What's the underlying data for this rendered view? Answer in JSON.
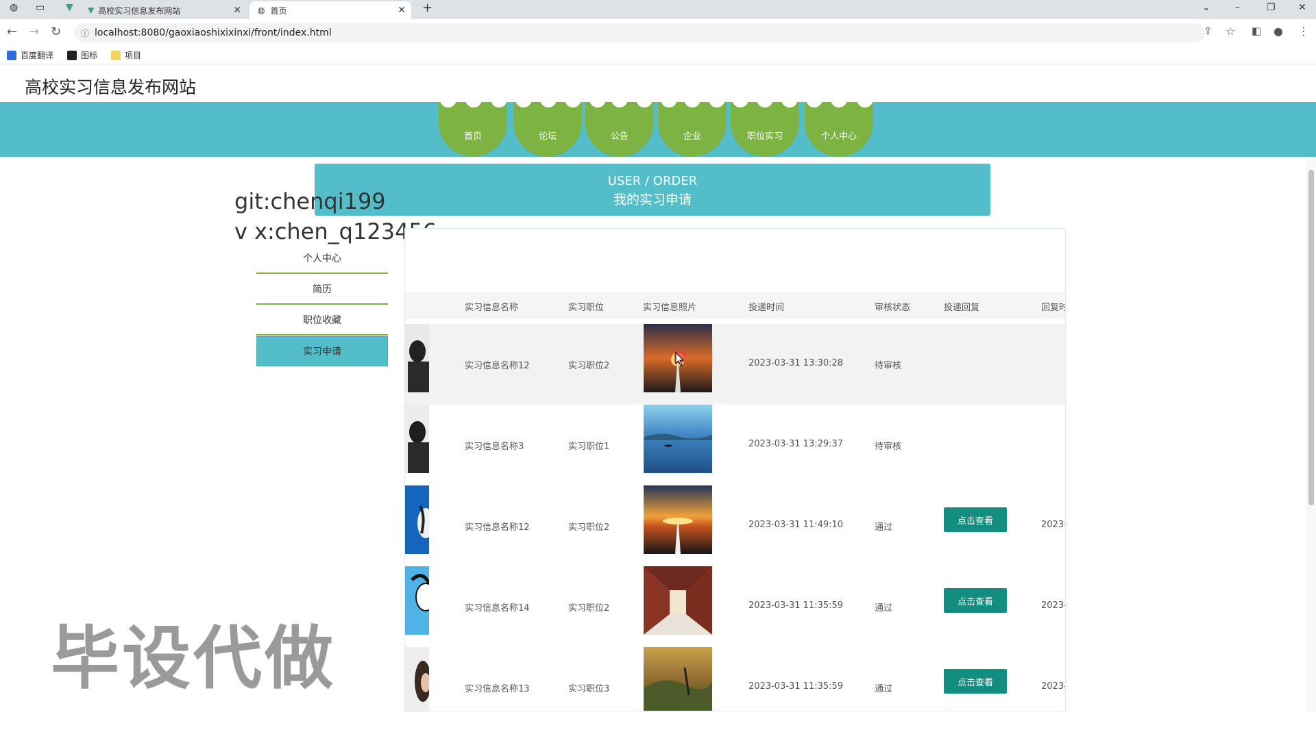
{
  "browser": {
    "tabs": [
      {
        "title": "高校实习信息发布网站"
      },
      {
        "title": "首页"
      }
    ],
    "url": "localhost:8080/gaoxiaoshixixinxi/front/index.html",
    "bookmarks": [
      "百度翻译",
      "图标",
      "项目"
    ]
  },
  "site": {
    "title": "高校实习信息发布网站",
    "nav": [
      "首页",
      "论坛",
      "公告",
      "企业",
      "职位实习",
      "个人中心"
    ]
  },
  "banner": {
    "en": "USER / ORDER",
    "cn": "我的实习申请"
  },
  "overlay": {
    "line1": "git:chenqi199",
    "line2": "v x:chen_q123456"
  },
  "watermark": "毕设代做",
  "sidebar": {
    "items": [
      "个人中心",
      "简历",
      "职位收藏",
      "实习申请"
    ],
    "active_index": 3
  },
  "table": {
    "headers": [
      "实习信息名称",
      "实习职位",
      "实习信息照片",
      "投递时间",
      "审核状态",
      "投递回复",
      "回复时"
    ],
    "rows": [
      {
        "name": "实习信息名称12",
        "position": "实习职位2",
        "time": "2023-03-31 13:30:28",
        "status": "待审核",
        "reply": "",
        "reply_time": ""
      },
      {
        "name": "实习信息名称3",
        "position": "实习职位1",
        "time": "2023-03-31 13:29:37",
        "status": "待审核",
        "reply": "",
        "reply_time": ""
      },
      {
        "name": "实习信息名称12",
        "position": "实习职位2",
        "time": "2023-03-31 11:49:10",
        "status": "通过",
        "reply": "点击查看",
        "reply_time": "2023-"
      },
      {
        "name": "实习信息名称14",
        "position": "实习职位2",
        "time": "2023-03-31 11:35:59",
        "status": "通过",
        "reply": "点击查看",
        "reply_time": "2023-"
      },
      {
        "name": "实习信息名称13",
        "position": "实习职位3",
        "time": "2023-03-31 11:35:59",
        "status": "通过",
        "reply": "点击查看",
        "reply_time": "2023-"
      }
    ]
  },
  "colors": {
    "teal": "#53bec9",
    "green": "#7cb342",
    "button": "#138d80"
  }
}
